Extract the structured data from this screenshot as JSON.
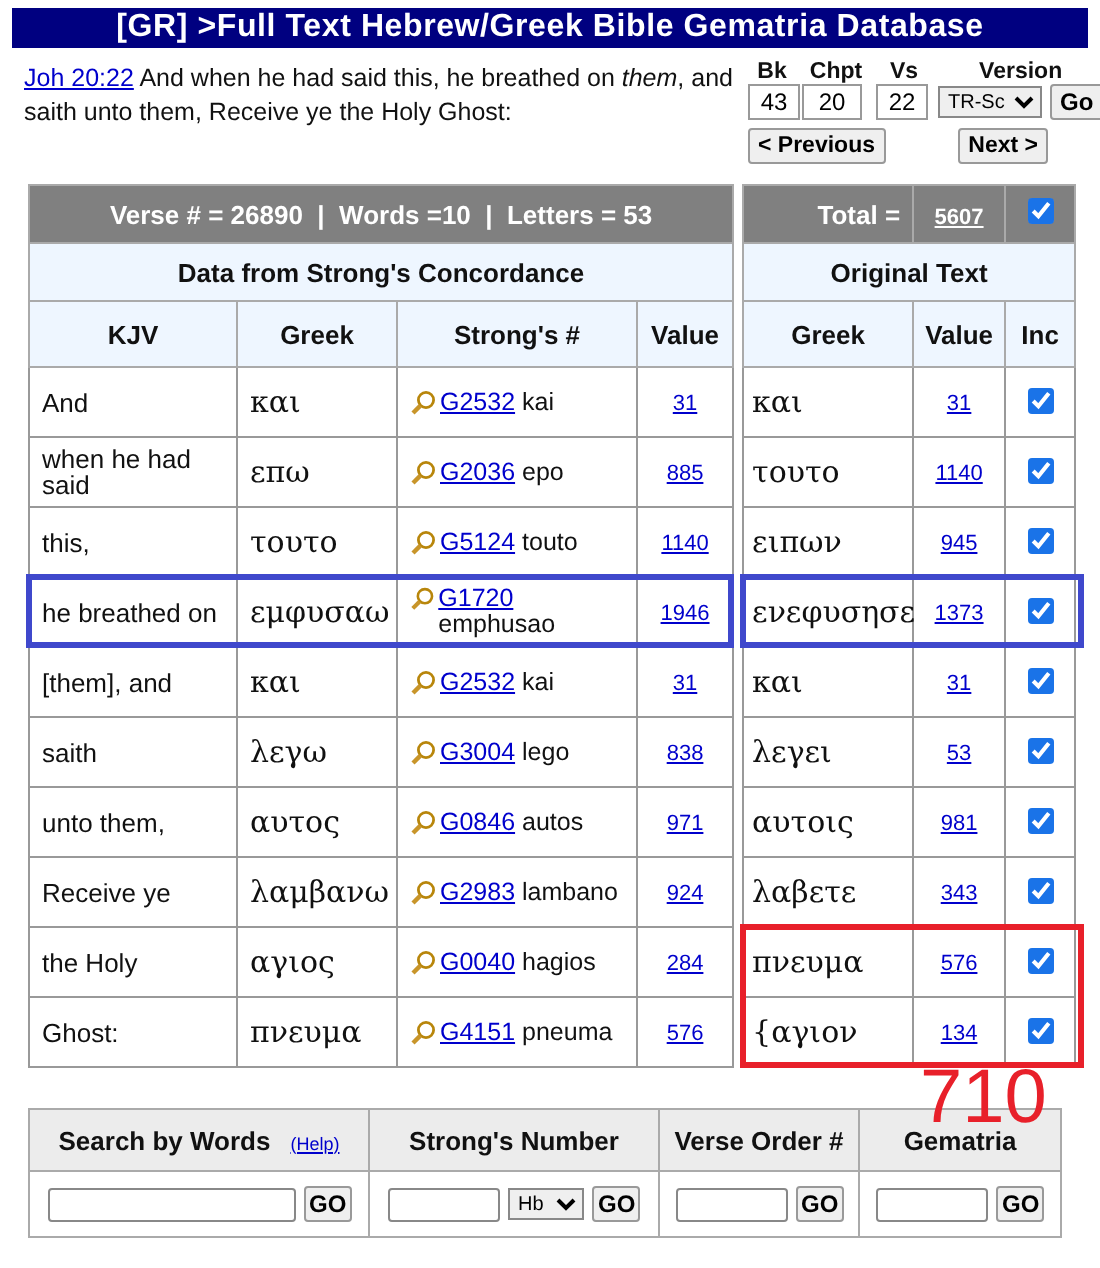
{
  "title": "[GR] >Full Text Hebrew/Greek Bible Gematria Database",
  "verse": {
    "ref": "Joh 20:22",
    "text": "And when he had said this, he breathed on *them*, and saith unto them, Receive ye the Holy Ghost:"
  },
  "nav": {
    "labels": [
      "Bk",
      "Chpt",
      "Vs",
      "Version"
    ],
    "book": "43",
    "chapter": "20",
    "verse": "22",
    "version": "TR-Sc",
    "go": "Go",
    "previous": "< Previous",
    "next": "Next >"
  },
  "summary": "Verse # = 26890  |  Words =10  |  Letters = 53",
  "strongs_table": {
    "caption": "Data from Strong's Concordance",
    "columns": [
      "KJV",
      "Greek",
      "Strong's #",
      "Value"
    ],
    "rows": [
      {
        "kjv": "And",
        "greek": "και",
        "strongs": "G2532",
        "translit": "kai",
        "value": "31",
        "highlighted": false
      },
      {
        "kjv": "when he had said",
        "greek": "επω",
        "strongs": "G2036",
        "translit": "epo",
        "value": "885",
        "highlighted": false
      },
      {
        "kjv": "this,",
        "greek": "τουτο",
        "strongs": "G5124",
        "translit": "touto",
        "value": "1140",
        "highlighted": false
      },
      {
        "kjv": "he breathed on",
        "greek": "εμφυσαω",
        "strongs": "G1720",
        "translit": "emphusao",
        "value": "1946",
        "highlighted": true,
        "color": "#3f48cc"
      },
      {
        "kjv": "[them], and",
        "greek": "και",
        "strongs": "G2532",
        "translit": "kai",
        "value": "31",
        "highlighted": false
      },
      {
        "kjv": "saith",
        "greek": "λεγω",
        "strongs": "G3004",
        "translit": "lego",
        "value": "838",
        "highlighted": false
      },
      {
        "kjv": "unto them,",
        "greek": "αυτος",
        "strongs": "G0846",
        "translit": "autos",
        "value": "971",
        "highlighted": false
      },
      {
        "kjv": "Receive ye",
        "greek": "λαμβανω",
        "strongs": "G2983",
        "translit": "lambano",
        "value": "924",
        "highlighted": false
      },
      {
        "kjv": "the Holy",
        "greek": "αγιος",
        "strongs": "G0040",
        "translit": "hagios",
        "value": "284",
        "highlighted": false
      },
      {
        "kjv": "Ghost:",
        "greek": "πνευμα",
        "strongs": "G4151",
        "translit": "pneuma",
        "value": "576",
        "highlighted": false
      }
    ]
  },
  "original_table": {
    "total_label": "Total =",
    "total": "5607",
    "total_checked": true,
    "caption": "Original Text",
    "columns": [
      "Greek",
      "Value",
      "Inc"
    ],
    "rows": [
      {
        "greek": "και",
        "value": "31",
        "included": true,
        "highlighted": false
      },
      {
        "greek": "τουτο",
        "value": "1140",
        "included": true,
        "highlighted": false
      },
      {
        "greek": "ειπων",
        "value": "945",
        "included": true,
        "highlighted": false
      },
      {
        "greek": "ενεφυσησε",
        "value": "1373",
        "included": true,
        "highlighted": true,
        "color": "#3f48cc"
      },
      {
        "greek": "και",
        "value": "31",
        "included": true,
        "highlighted": false
      },
      {
        "greek": "λεγει",
        "value": "53",
        "included": true,
        "highlighted": false
      },
      {
        "greek": "αυτοις",
        "value": "981",
        "included": true,
        "highlighted": false
      },
      {
        "greek": "λαβετε",
        "value": "343",
        "included": true,
        "highlighted": false
      },
      {
        "greek": "πνευμα",
        "value": "576",
        "included": true,
        "highlighted": true,
        "color": "#e8202a"
      },
      {
        "greek": "{αγιον",
        "value": "134",
        "included": true,
        "highlighted": true,
        "color": "#e8202a"
      }
    ]
  },
  "annotation": "710",
  "search": {
    "columns": [
      {
        "kind": "words",
        "label": "Search by Words",
        "help": "(Help)",
        "go": "GO"
      },
      {
        "kind": "strongs",
        "label": "Strong's Number",
        "select": "Hb",
        "go": "GO"
      },
      {
        "kind": "plain",
        "label": "Verse Order #",
        "go": "GO"
      },
      {
        "kind": "plain",
        "label": "Gematria",
        "go": "GO"
      }
    ]
  }
}
